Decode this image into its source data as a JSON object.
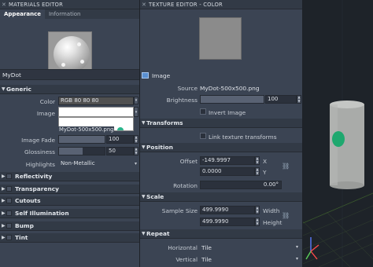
{
  "materials_editor": {
    "title": "MATERIALS EDITOR",
    "tabs": [
      "Appearance",
      "Information"
    ],
    "material_name": "MyDot",
    "generic": {
      "header": "Generic",
      "color_label": "Color",
      "color_value": "RGB 80 80 80",
      "image_label": "Image",
      "image_filename": "MyDot-500x500.png",
      "image_fade_label": "Image Fade",
      "image_fade_value": "100",
      "glossiness_label": "Glossiness",
      "glossiness_value": "50",
      "highlights_label": "Highlights",
      "highlights_value": "Non-Metallic"
    },
    "sections": [
      "Reflectivity",
      "Transparency",
      "Cutouts",
      "Self Illumination",
      "Bump",
      "Tint"
    ]
  },
  "texture_editor": {
    "title": "TEXTURE EDITOR - COLOR",
    "image_header": "Image",
    "source_label": "Source",
    "source_value": "MyDot-500x500.png",
    "brightness_label": "Brightness",
    "brightness_value": "100",
    "invert_label": "Invert Image",
    "transforms_header": "Transforms",
    "link_transforms_label": "Link texture transforms",
    "position_header": "Position",
    "offset_label": "Offset",
    "offset_x": "-149.9997",
    "offset_y": "0.0000",
    "x_axis": "X",
    "y_axis": "Y",
    "rotation_label": "Rotation",
    "rotation_value": "0.00°",
    "scale_header": "Scale",
    "sample_size_label": "Sample Size",
    "width_value": "499.9990",
    "width_label": "Width",
    "height_value": "499.9990",
    "height_label": "Height",
    "repeat_header": "Repeat",
    "horizontal_label": "Horizontal",
    "horizontal_value": "Tile",
    "vertical_label": "Vertical",
    "vertical_value": "Tile"
  },
  "colors": {
    "panel_bg": "#3b4453",
    "header_bg": "#323a46",
    "viewport_bg": "#1e2329",
    "cylinder": "#a9aba9",
    "dot": "#1fa86f"
  }
}
